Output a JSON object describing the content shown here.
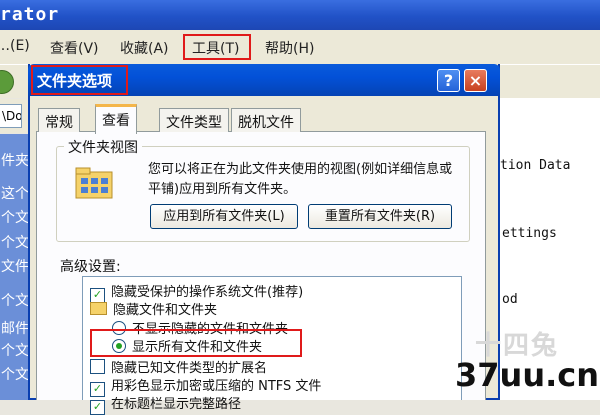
{
  "window": {
    "title": "rator"
  },
  "menu": [
    {
      "label": "…(E)",
      "short": "E"
    },
    {
      "label": "查看(V)"
    },
    {
      "label": "收藏(A)"
    },
    {
      "label": "工具(T)"
    },
    {
      "label": "帮助(H)"
    }
  ],
  "address": "\\Do",
  "sidebar_fragments": [
    "件夹",
    "这个",
    "个文",
    "个文",
    "文件",
    "个文",
    "邮件",
    "个文",
    "个文"
  ],
  "right_files": [
    "tion Data",
    "ettings",
    "od"
  ],
  "dialog": {
    "title": "文件夹选项",
    "help_label": "?",
    "close_label": "×",
    "tabs": [
      "常规",
      "查看",
      "文件类型",
      "脱机文件"
    ],
    "active_tab": "查看",
    "folder_views": {
      "group_title": "文件夹视图",
      "description": "您可以将正在为此文件夹使用的视图(例如详细信息或平铺)应用到所有文件夹。",
      "apply_button": "应用到所有文件夹(L)",
      "reset_button": "重置所有文件夹(R)"
    },
    "advanced": {
      "label": "高级设置:",
      "items": [
        {
          "type": "checkbox",
          "checked": true,
          "text": "隐藏受保护的操作系统文件(推荐)"
        },
        {
          "type": "folder",
          "text": "隐藏文件和文件夹"
        },
        {
          "type": "radio",
          "checked": false,
          "text": "不显示隐藏的文件和文件夹"
        },
        {
          "type": "radio",
          "checked": true,
          "text": "显示所有文件和文件夹"
        },
        {
          "type": "checkbox",
          "checked": false,
          "text": "隐藏已知文件类型的扩展名"
        },
        {
          "type": "checkbox",
          "checked": true,
          "text": "用彩色显示加密或压缩的 NTFS 文件"
        },
        {
          "type": "checkbox",
          "checked": true,
          "text": "在标题栏显示完整路径"
        }
      ]
    }
  },
  "watermark": {
    "logo": "十四兔",
    "site": "37uu.cn"
  },
  "colors": {
    "xp_blue": "#0351d8",
    "highlight_red": "#e01a1a",
    "dialog_bg": "#ece9d8",
    "check_green": "#21a121"
  }
}
